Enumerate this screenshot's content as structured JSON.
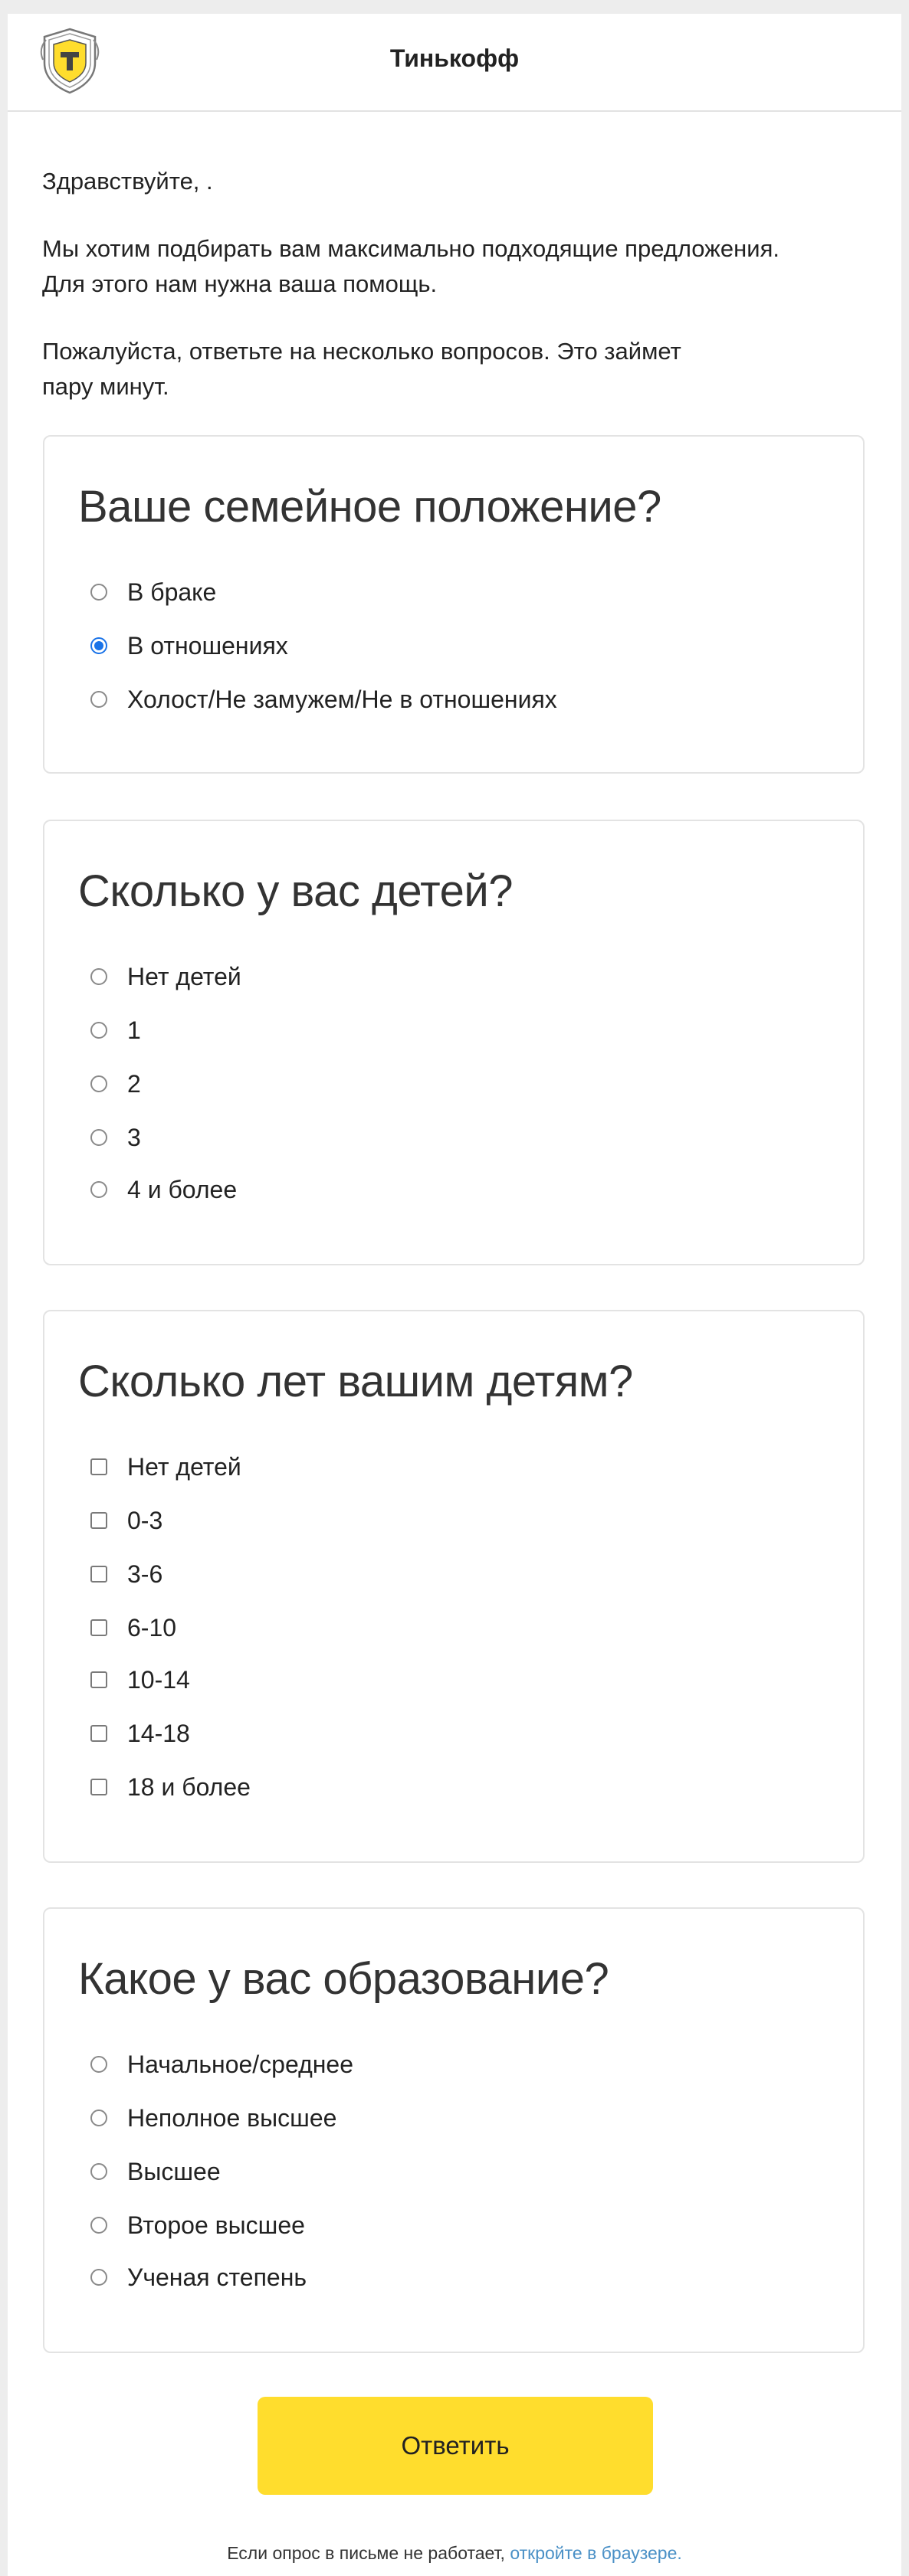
{
  "header": {
    "brand": "Тинькофф",
    "logo_icon": "tinkoff-shield-icon"
  },
  "intro": {
    "greeting": "Здравствуйте, .",
    "line1": "Мы хотим подбирать вам максимально подходящие предложения.",
    "line2": "Для этого нам нужна ваша помощь.",
    "line3": "Пожалуйста, ответьте на несколько вопросов. Это займет",
    "line4": "пару минут."
  },
  "questions": [
    {
      "title": "Ваше семейное положение?",
      "type": "radio",
      "options": [
        "В браке",
        "В отношениях",
        "Холост/Не замужем/Не в отношениях"
      ],
      "selected": "В отношениях"
    },
    {
      "title": "Сколько у вас детей?",
      "type": "radio",
      "options": [
        "Нет детей",
        "1",
        "2",
        "3",
        "4 и более"
      ],
      "selected": null
    },
    {
      "title": "Сколько лет вашим детям?",
      "type": "checkbox",
      "options": [
        "Нет детей",
        "0-3",
        "3-6",
        "6-10",
        "10-14",
        "14-18",
        "18 и более"
      ]
    },
    {
      "title": "Какое у вас образование?",
      "type": "radio",
      "options": [
        "Начальное/среднее",
        "Неполное высшее",
        "Высшее",
        "Второе высшее",
        "Ученая степень"
      ],
      "selected": null
    }
  ],
  "submit_label": "Ответить",
  "footer": {
    "text": "Если опрос в письме не работает, ",
    "link": "откройте в браузере."
  },
  "colors": {
    "accent": "#ffdd2d",
    "radio_checked": "#1a73e8",
    "link": "#4a90c6"
  }
}
